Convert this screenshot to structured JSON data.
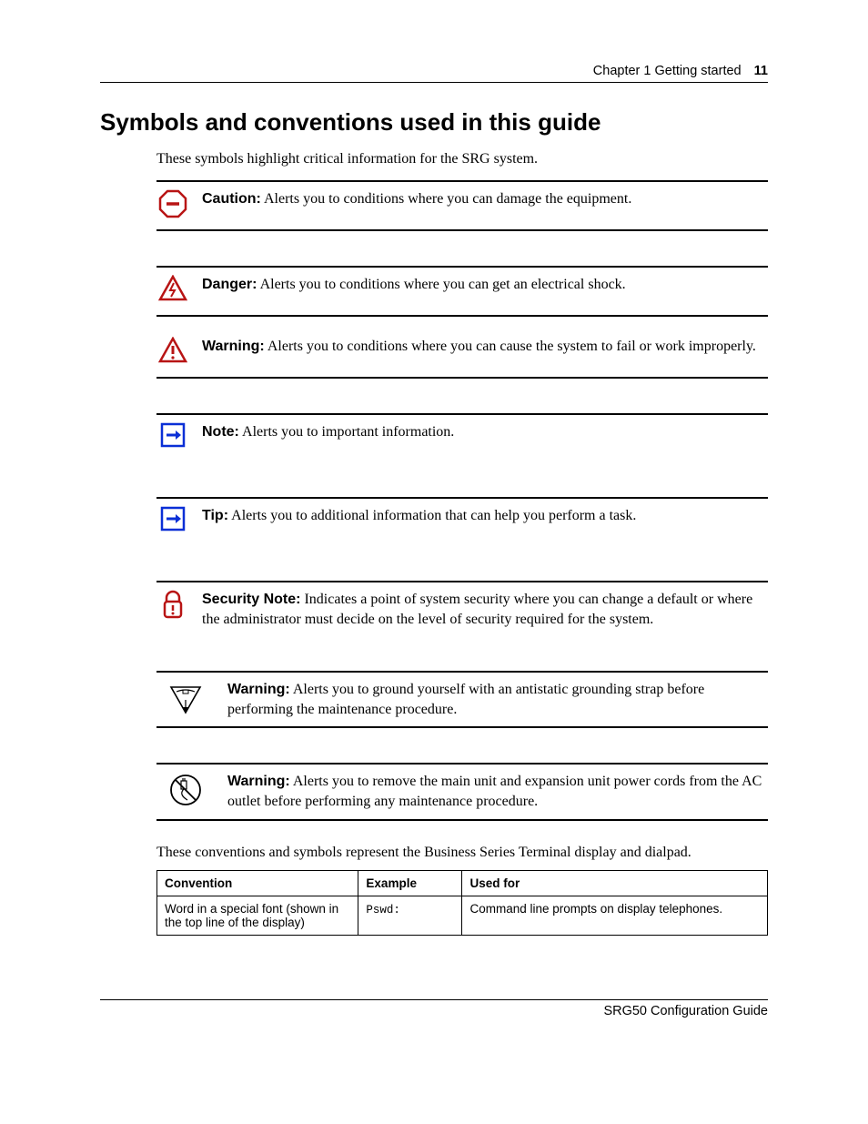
{
  "header": {
    "chapter_label": "Chapter 1  Getting started",
    "page_number": "11"
  },
  "heading": "Symbols and conventions used in this guide",
  "intro": "These symbols highlight critical information for the SRG system.",
  "symbols": [
    {
      "icon": "caution-octagon-icon",
      "label": "Caution:",
      "text": " Alerts you to conditions where you can damage the equipment."
    },
    {
      "icon": "danger-shock-icon",
      "label": "Danger:",
      "text": " Alerts you to conditions where you can get an electrical shock."
    },
    {
      "icon": "warning-triangle-icon",
      "label": "Warning:",
      "text": " Alerts you to conditions where you can cause the system to fail or work improperly."
    },
    {
      "icon": "note-arrow-icon",
      "label": "Note:",
      "text": " Alerts you to important information."
    },
    {
      "icon": "tip-arrow-icon",
      "label": "Tip:",
      "text": " Alerts you to additional information that can help you perform a task."
    },
    {
      "icon": "security-lock-icon",
      "label": "Security Note:",
      "text": " Indicates a point of system security where you can change a default or where the administrator must decide on the level of security required for the system."
    }
  ],
  "warnings": [
    {
      "icon": "antistatic-strap-icon",
      "label": "Warning:",
      "text": " Alerts you to ground yourself with an antistatic grounding strap before performing the maintenance procedure."
    },
    {
      "icon": "unplug-power-icon",
      "label": "Warning:",
      "text": " Alerts you to remove the main unit and expansion unit power cords from the AC outlet before performing any maintenance procedure."
    }
  ],
  "conventions_intro": "These conventions and symbols represent the Business Series Terminal display and dialpad.",
  "conventions_table": {
    "headers": [
      "Convention",
      "Example",
      "Used for"
    ],
    "rows": [
      {
        "convention": "Word in a special font (shown in the top line of the display)",
        "example": "Pswd:",
        "used_for": "Command line prompts on display telephones."
      }
    ]
  },
  "footer": "SRG50 Configuration Guide"
}
